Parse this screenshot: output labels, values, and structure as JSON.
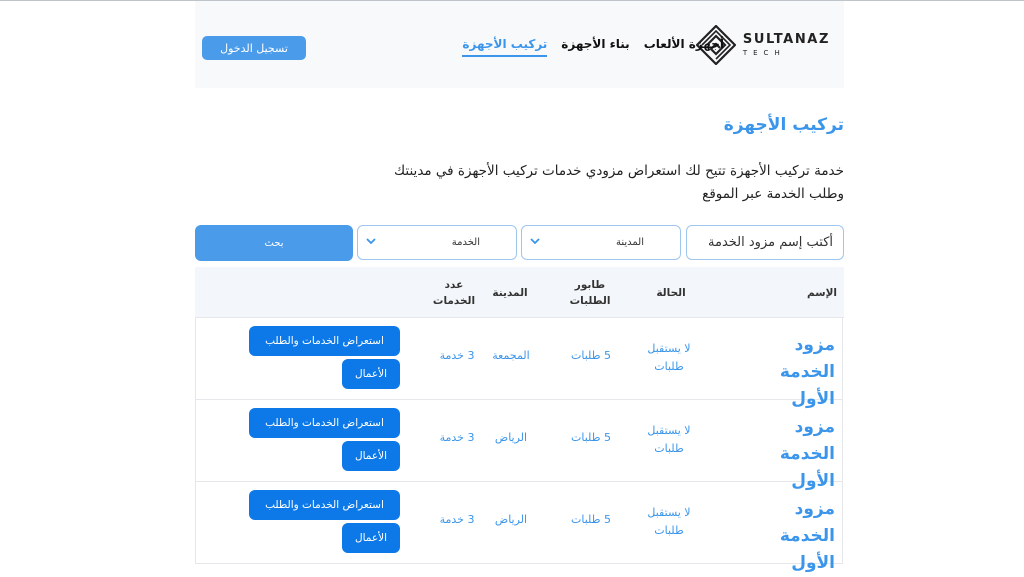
{
  "brand": {
    "title": "SULTANAZ",
    "subtitle": "TECH"
  },
  "nav": {
    "items": [
      {
        "label": "أجهزة الألعاب"
      },
      {
        "label": "بناء الأجهزة"
      },
      {
        "label": "تركيب الأجهزة",
        "active": true
      }
    ]
  },
  "header": {
    "login_label": "تسجيل الدخول"
  },
  "page": {
    "title": "تركيب الأجهزة",
    "description": "خدمة تركيب الأجهزة تتيح لك استعراض مزودي خدمات تركيب الأجهزة في مدينتك وطلب الخدمة عبر الموقع"
  },
  "filters": {
    "search_placeholder": "أكتب إسم مزود الخدمة",
    "city_label": "المدينة",
    "service_label": "الخدمة",
    "search_button": "بحث"
  },
  "table": {
    "headers": {
      "name": "الإسم",
      "status": "الحالة",
      "queue": "طابور الطلبات",
      "city": "المدينة",
      "count": "عدد الخدمات"
    },
    "rows": [
      {
        "name": "مزود الخدمة الأول",
        "status": "لا يستقبل طلبات",
        "queue": "5 طلبات",
        "city": "المجمعة",
        "count": "3 خدمة"
      },
      {
        "name": "مزود الخدمة الأول",
        "status": "لا يستقبل طلبات",
        "queue": "5 طلبات",
        "city": "الرياض",
        "count": "3 خدمة"
      },
      {
        "name": "مزود الخدمة الأول",
        "status": "لا يستقبل طلبات",
        "queue": "5 طلبات",
        "city": "الرياض",
        "count": "3 خدمة"
      }
    ],
    "row_actions": {
      "services_label": "استعراض الخدمات والطلب",
      "works_label": "الأعمال"
    }
  },
  "colors": {
    "accent": "#3b95ea",
    "button": "#0d79e8",
    "header_bg": "#f8f9fa"
  }
}
